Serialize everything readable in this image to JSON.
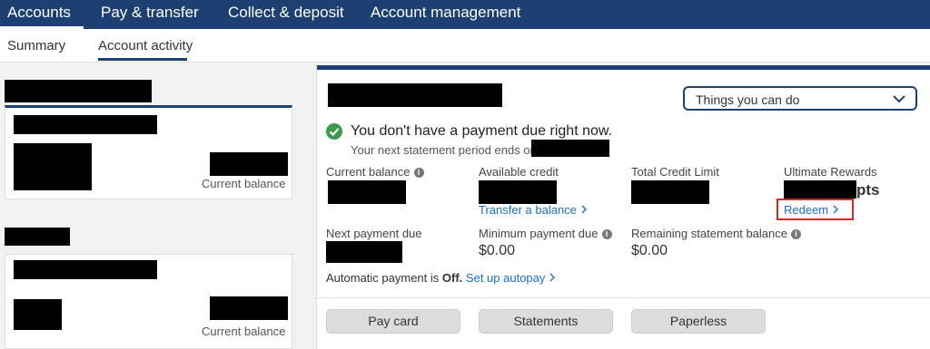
{
  "topnav": {
    "items": [
      "Accounts",
      "Pay & transfer",
      "Collect & deposit",
      "Account management"
    ]
  },
  "subnav": {
    "items": [
      "Summary",
      "Account activity"
    ]
  },
  "accounts": [
    {
      "balance_label": "Current balance"
    },
    {
      "balance_label": "Current balance"
    }
  ],
  "panel": {
    "dropdown_label": "Things you can do",
    "payment_message": "You don't have a payment due right now.",
    "statement_message": "Your next statement period ends on",
    "fields": {
      "current_balance": {
        "label": "Current balance"
      },
      "available_credit": {
        "label": "Available credit",
        "link": "Transfer a balance"
      },
      "total_credit_limit": {
        "label": "Total Credit Limit"
      },
      "ultimate_rewards": {
        "label": "Ultimate Rewards",
        "unit": "pts",
        "link": "Redeem"
      },
      "next_payment_due": {
        "label": "Next payment due"
      },
      "minimum_payment_due": {
        "label": "Minimum payment due",
        "value": "$0.00"
      },
      "remaining_statement_balance": {
        "label": "Remaining statement balance",
        "value": "$0.00"
      }
    },
    "autopay": {
      "prefix": "Automatic payment is",
      "status": "Off.",
      "link": "Set up autopay"
    },
    "buttons": [
      "Pay card",
      "Statements",
      "Paperless"
    ]
  },
  "colors": {
    "navy": "#1d3f72",
    "link": "#1a6fc4",
    "success": "#3a9b4b",
    "highlight": "#e02424"
  }
}
